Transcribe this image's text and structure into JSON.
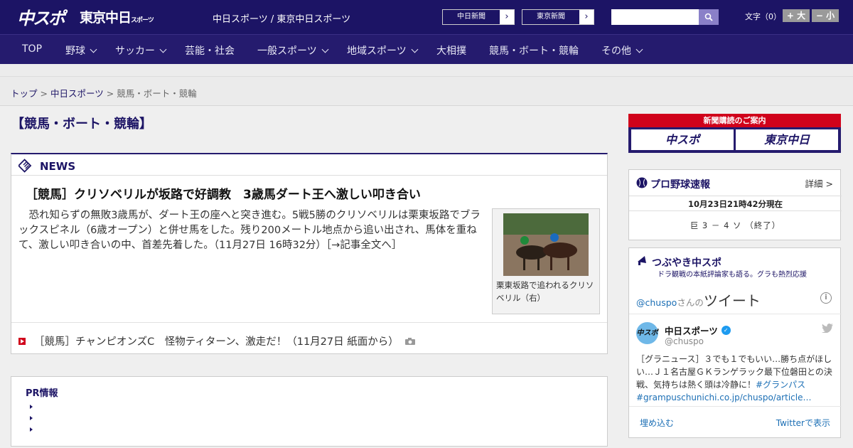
{
  "header": {
    "logo_main": "中スポ",
    "logo_sub": "東京中日",
    "logo_sub_small": "スポーツ",
    "site_names": "中日スポーツ / 東京中日スポーツ",
    "paper_links": [
      "中日新聞",
      "東京新聞"
    ],
    "font_size_label": "文字（0）",
    "font_bigger": "+ 大",
    "font_smaller": "− 小",
    "search_placeholder": ""
  },
  "nav": {
    "items": [
      {
        "label": "TOP",
        "dropdown": false
      },
      {
        "label": "野球",
        "dropdown": true
      },
      {
        "label": "サッカー",
        "dropdown": true
      },
      {
        "label": "芸能・社会",
        "dropdown": false
      },
      {
        "label": "一般スポーツ",
        "dropdown": true
      },
      {
        "label": "地域スポーツ",
        "dropdown": true
      },
      {
        "label": "大相撲",
        "dropdown": false
      },
      {
        "label": "競馬・ボート・競輪",
        "dropdown": false
      },
      {
        "label": "その他",
        "dropdown": true
      }
    ]
  },
  "breadcrumb": {
    "items": [
      "トップ",
      "中日スポーツ",
      "競馬・ボート・競輪"
    ],
    "separator": ">"
  },
  "page": {
    "title": "【競馬・ボート・競輪】"
  },
  "news": {
    "label": "NEWS",
    "headline": "［競馬］クリソベリルが坂路で好調教　3歳馬ダート王へ激しい叩き合い",
    "lead": "恐れ知らずの無敗3歳馬が、ダート王の座へと突き進む。5戦5勝のクリソベリルは栗東坂路でブラックスピネル（6歳オープン）と併せ馬をした。残り200メートル地点から追い出され、馬体を重ねて、激しい叩き合いの中、首差先着した。（11月27日 16時32分）［→記事全文へ］",
    "photo_caption": "栗東坂路で追われるクリソベリル（右）",
    "sub_headline": "［競馬］チャンピオンズC　怪物ティターン、激走だ！（11月27日 紙面から）"
  },
  "pr": {
    "title": "PR情報",
    "items": [
      "",
      "",
      ""
    ]
  },
  "sidebar": {
    "subscribe": {
      "top": "新聞購読のご案内",
      "left": "中スポ",
      "right": "東京中日"
    },
    "baseball": {
      "title": "プロ野球速報",
      "detail": "詳細 >",
      "timestamp": "10月23日21時42分現在",
      "score": "巨 3 － 4 ソ （終了）"
    },
    "twitter": {
      "title": "つぶやき中スポ",
      "subtitle": "ドラ観戦の本紙評論家も語る。グラも熱烈応援",
      "handle": "@chuspo",
      "handle_suffix": "さんの",
      "tweet_word": "ツイート",
      "account_name": "中日スポーツ",
      "screen_name": "@chuspo",
      "tweet_text": "［グラニュース］３でも１でもいい…勝ち点がほしい…Ｊ１名古屋ＧＫランゲラック最下位磐田との決戦、気持ちは熱く頭は冷静に！",
      "tweet_hashtag": "#グランパス",
      "tweet_link": "#grampuschunichi.co.jp/chuspo/article…",
      "embed": "埋め込む",
      "view_on": "Twitterで表示"
    }
  },
  "colors": {
    "brand_navy": "#1c1465",
    "nav_bg": "#251b6e",
    "accent_red": "#d0021b",
    "link_blue": "#1c6fb5"
  }
}
